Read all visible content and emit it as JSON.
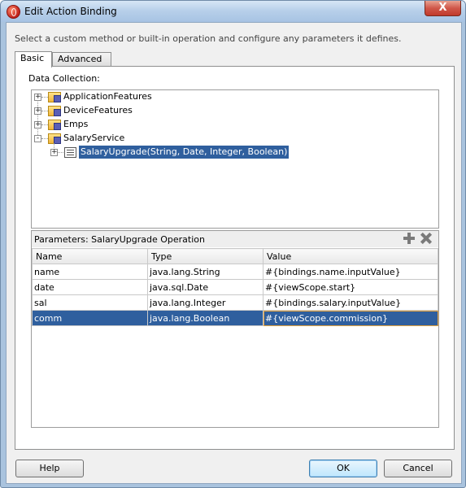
{
  "window": {
    "title": "Edit Action Binding",
    "close_label": "X"
  },
  "description": "Select a custom method or built-in operation and configure any parameters it defines.",
  "tabs": [
    {
      "label": "Basic",
      "active": true
    },
    {
      "label": "Advanced",
      "active": false
    }
  ],
  "data_collection": {
    "label": "Data Collection:",
    "tree": [
      {
        "label": "ApplicationFeatures",
        "expander": "+"
      },
      {
        "label": "DeviceFeatures",
        "expander": "+"
      },
      {
        "label": "Emps",
        "expander": "+"
      },
      {
        "label": "SalaryService",
        "expander": "-"
      },
      {
        "label": "SalaryUpgrade(String, Date, Integer, Boolean)",
        "expander": "+",
        "selected": true
      }
    ]
  },
  "parameters": {
    "label": "Parameters:  SalaryUpgrade Operation",
    "columns": [
      "Name",
      "Type",
      "Value"
    ],
    "rows": [
      [
        "name",
        "java.lang.String",
        "#{bindings.name.inputValue}"
      ],
      [
        "date",
        "java.sql.Date",
        "#{viewScope.start}"
      ],
      [
        "sal",
        "java.lang.Integer",
        "#{bindings.salary.inputValue}"
      ],
      [
        "comm",
        "java.lang.Boolean",
        "#{viewScope.commission}"
      ]
    ],
    "selected_row": 3
  },
  "buttons": {
    "help": "Help",
    "ok": "OK",
    "cancel": "Cancel"
  },
  "icons": {
    "add": "plus-icon",
    "delete": "delete-icon",
    "app": "oracle-icon"
  }
}
